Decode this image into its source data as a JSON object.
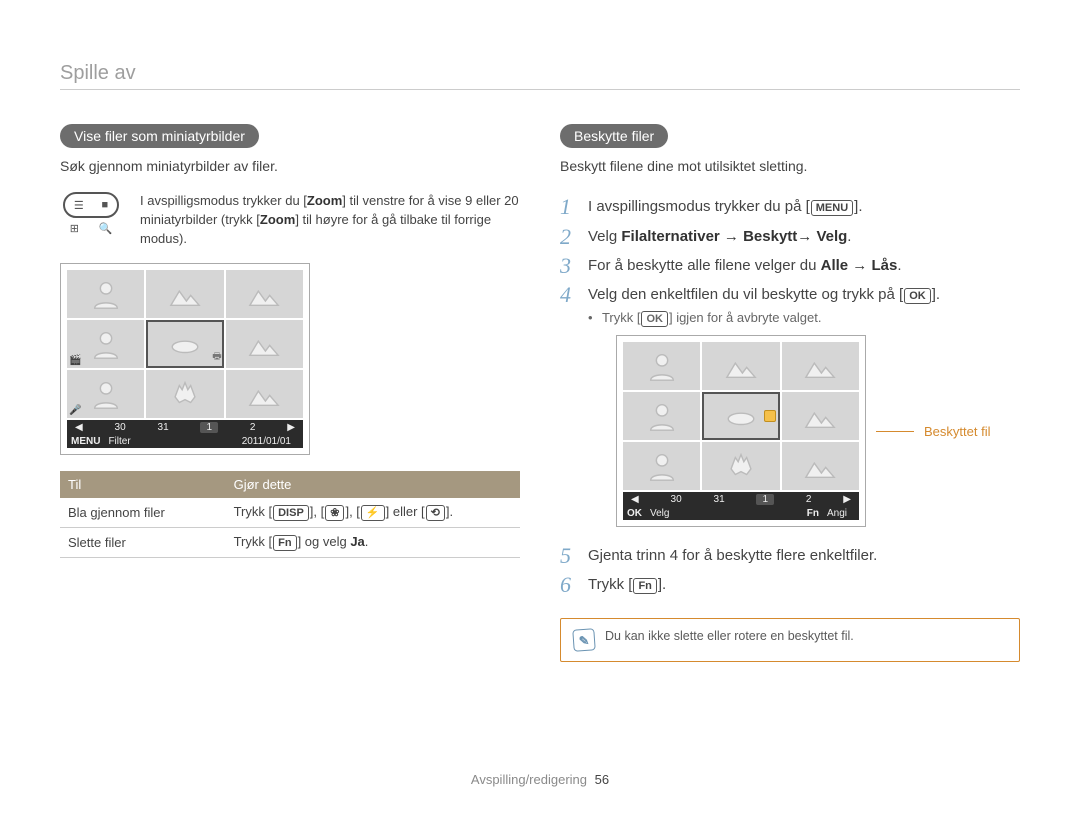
{
  "section_title": "Spille av",
  "left": {
    "heading": "Vise filer som miniatyrbilder",
    "intro": "Søk gjennom miniatyrbilder av filer.",
    "zoom_text_pre": "I avspilligsmodus trykker du [",
    "zoom_btn": "Zoom",
    "zoom_text_mid1": "] til venstre for å vise 9 eller 20 miniatyrbilder (trykk [",
    "zoom_text_mid2": "] til høyre for å gå tilbake til forrige modus).",
    "zoom_top_left": "☰",
    "zoom_top_right": "■",
    "zoom_bot_left": "⊞",
    "zoom_bot_right": "🔍",
    "screen": {
      "pages": [
        "30",
        "31",
        "1",
        "2"
      ],
      "filter_label": "Filter",
      "date": "2011/01/01",
      "menu_label": "MENU"
    },
    "table": {
      "h1": "Til",
      "h2": "Gjør dette",
      "r1c1": "Bla gjennom filer",
      "r1c2_pre": "Trykk [",
      "r1c2_b1": "DISP",
      "r1c2_sep": "], [",
      "r1c2_b2": "❀",
      "r1c2_b3": "⚡",
      "r1c2_or": "] eller [",
      "r1c2_b4": "⟲",
      "r1c2_post": "].",
      "r2c1": "Slette filer",
      "r2c2_pre": "Trykk [",
      "r2c2_b1": "Fn",
      "r2c2_mid": "] og velg ",
      "r2c2_ja": "Ja",
      "r2c2_post": "."
    }
  },
  "right": {
    "heading": "Beskytte filer",
    "intro": "Beskytt filene dine mot utilsiktet sletting.",
    "steps": {
      "s1_pre": "I avspillingsmodus trykker du på [",
      "s1_btn": "MENU",
      "s1_post": "].",
      "s2_pre": "Velg ",
      "s2_bold": "Filalternativer → Beskytt→ Velg",
      "s2_post": ".",
      "s3_pre": "For å beskytte alle filene velger du ",
      "s3_bold": "Alle → Lås",
      "s3_post": ".",
      "s4_pre": "Velg den enkeltfilen du vil beskytte og trykk på [",
      "s4_btn": "OK",
      "s4_post": "].",
      "s4_bullet_pre": "Trykk [",
      "s4_bullet_btn": "OK",
      "s4_bullet_post": "] igjen for å avbryte valget.",
      "s5": "Gjenta trinn 4 for å beskytte flere enkeltfiler.",
      "s6_pre": "Trykk [",
      "s6_btn": "Fn",
      "s6_post": "]."
    },
    "screen": {
      "pages": [
        "30",
        "31",
        "1",
        "2"
      ],
      "ok_label": "OK",
      "velg_label": "Velg",
      "fn_label": "Fn",
      "angi_label": "Angi",
      "callout": "Beskyttet fil"
    },
    "note": "Du kan ikke slette eller rotere en beskyttet fil."
  },
  "footer": {
    "section": "Avspilling/redigering",
    "page": "56"
  }
}
